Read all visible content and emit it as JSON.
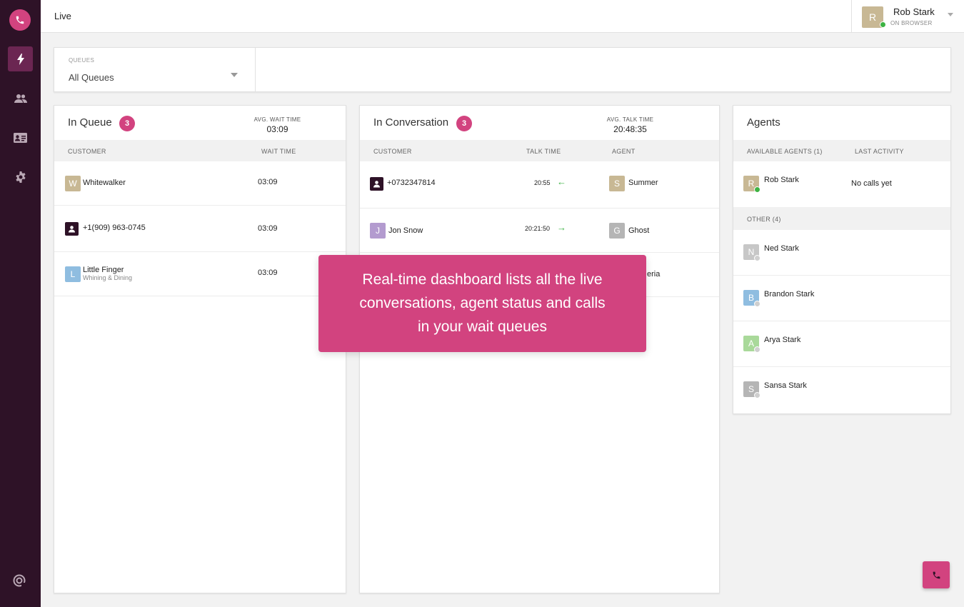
{
  "header": {
    "title": "Live",
    "user": {
      "initial": "R",
      "name": "Rob Stark",
      "status": "ON BROWSER",
      "avatar_color": "#c8b894",
      "status_color": "#3db343"
    }
  },
  "filter": {
    "label": "QUEUES",
    "value": "All Queues"
  },
  "queue": {
    "title": "In Queue",
    "count": "3",
    "avg_label": "AVG. WAIT TIME",
    "avg_value": "03:09",
    "columns": [
      "CUSTOMER",
      "WAIT TIME"
    ],
    "rows": [
      {
        "initial": "W",
        "avatar_color": "#c8b894",
        "name": "Whitewalker",
        "sub": "",
        "wait": "03:09"
      },
      {
        "initial": "",
        "avatar_color": "#2e1227",
        "name": "+1(909) 963-0745",
        "sub": "",
        "wait": "03:09"
      },
      {
        "initial": "L",
        "avatar_color": "#8fbde0",
        "name": "Little Finger",
        "sub": "Whining & Dining",
        "wait": "03:09"
      }
    ]
  },
  "conversation": {
    "title": "In Conversation",
    "count": "3",
    "avg_label": "AVG. TALK TIME",
    "avg_value": "20:48:35",
    "columns": [
      "CUSTOMER",
      "TALK TIME",
      "AGENT"
    ],
    "rows": [
      {
        "initial": "",
        "avatar_color": "#2e1227",
        "name": "+0732347814",
        "talk": "20:55",
        "direction": "←",
        "agent_initial": "S",
        "agent_color": "#c8b894",
        "agent": "Summer"
      },
      {
        "initial": "J",
        "avatar_color": "#b39bcf",
        "name": "Jon Snow",
        "talk": "20:21:50",
        "direction": "→",
        "agent_initial": "G",
        "agent_color": "#b5b5b5",
        "agent": "Ghost"
      },
      {
        "agent_partial": "eria"
      }
    ],
    "arrow_color": "#3db343"
  },
  "agents": {
    "title": "Agents",
    "columns": [
      "AVAILABLE AGENTS (1)",
      "LAST ACTIVITY"
    ],
    "available": [
      {
        "initial": "R",
        "color": "#c8b894",
        "name": "Rob Stark",
        "activity": "No calls yet",
        "status_color": "#3db343"
      }
    ],
    "other_label": "OTHER (4)",
    "other": [
      {
        "initial": "N",
        "color": "#c7c7c7",
        "name": "Ned Stark"
      },
      {
        "initial": "B",
        "color": "#8fbde0",
        "name": "Brandon Stark"
      },
      {
        "initial": "A",
        "color": "#a9d99a",
        "name": "Arya Stark"
      },
      {
        "initial": "S",
        "color": "#b5b5b5",
        "name": "Sansa Stark"
      }
    ],
    "offline_color": "#cfcfcf"
  },
  "overlay": {
    "lines": [
      "Real-time dashboard lists all the live",
      "conversations, agent status and calls",
      "in your wait queues"
    ]
  },
  "colors": {
    "brand": "#d2437f",
    "sidebar": "#2e1227",
    "sidebar_active": "#6b2652"
  },
  "icons": [
    "phone-icon",
    "lightning-icon",
    "people-icon",
    "contact-card-icon",
    "gear-icon",
    "support-icon",
    "chevron-down-icon",
    "person-icon",
    "arrow-left-icon",
    "arrow-right-icon"
  ]
}
